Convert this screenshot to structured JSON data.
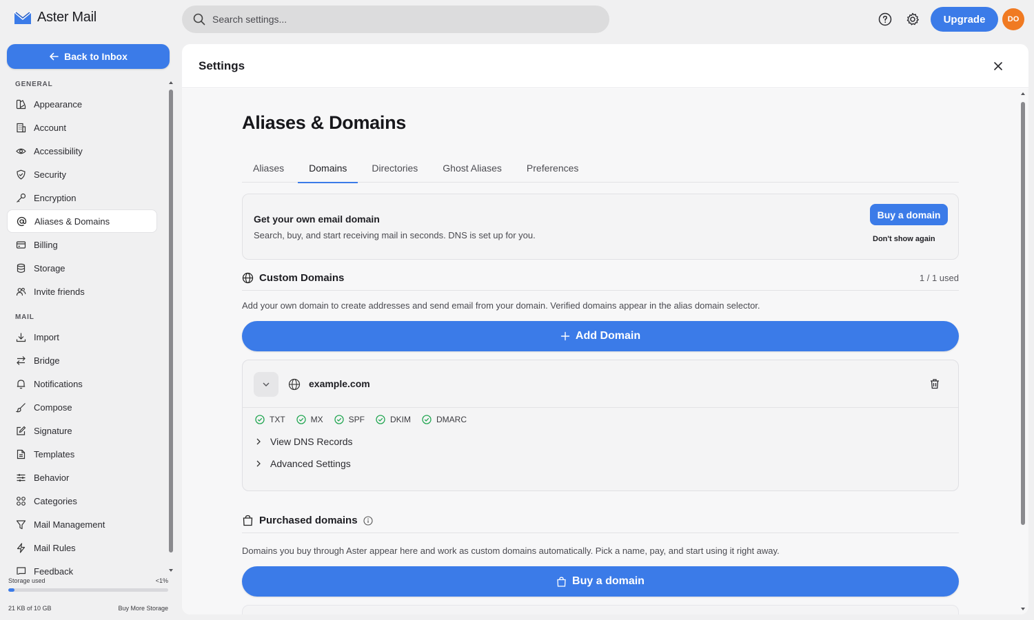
{
  "app": {
    "name": "Aster Mail"
  },
  "topbar": {
    "search_placeholder": "Search settings...",
    "upgrade_label": "Upgrade",
    "avatar_initials": "DO"
  },
  "sidebar": {
    "back_label": "Back to Inbox",
    "sections": [
      {
        "title": "GENERAL",
        "items": [
          "Appearance",
          "Account",
          "Accessibility",
          "Security",
          "Encryption",
          "Aliases & Domains",
          "Billing",
          "Storage",
          "Invite friends"
        ]
      },
      {
        "title": "MAIL",
        "items": [
          "Import",
          "Bridge",
          "Notifications",
          "Compose",
          "Signature",
          "Templates",
          "Behavior",
          "Categories",
          "Mail Management",
          "Mail Rules",
          "Feedback"
        ]
      }
    ],
    "active_item": "Aliases & Domains",
    "storage": {
      "label": "Storage used",
      "percent_text": "<1%",
      "used_text": "21 KB of 10 GB",
      "buy_more": "Buy More Storage",
      "fraction_used": 0.01
    }
  },
  "panel": {
    "title": "Settings",
    "page_title": "Aliases & Domains",
    "tabs": [
      "Aliases",
      "Domains",
      "Directories",
      "Ghost Aliases",
      "Preferences"
    ],
    "active_tab": "Domains",
    "promo": {
      "title": "Get your own email domain",
      "text": "Search, buy, and start receiving mail in seconds. DNS is set up for you.",
      "buy_label": "Buy a domain",
      "dismiss_label": "Don't show again"
    },
    "custom_domains": {
      "title": "Custom Domains",
      "count": "1 / 1 used",
      "description": "Add your own domain to create addresses and send email from your domain. Verified domains appear in the alias domain selector.",
      "add_label": "Add Domain",
      "domains": [
        {
          "name": "example.com",
          "records": [
            "TXT",
            "MX",
            "SPF",
            "DKIM",
            "DMARC"
          ],
          "view_dns": "View DNS Records",
          "advanced": "Advanced Settings"
        }
      ]
    },
    "purchased_domains": {
      "title": "Purchased domains",
      "description": "Domains you buy through Aster appear here and work as custom domains automatically. Pick a name, pay, and start using it right away.",
      "buy_label": "Buy a domain"
    }
  },
  "colors": {
    "accent": "#3b7be8",
    "avatar": "#f07a22",
    "check": "#22a652"
  }
}
